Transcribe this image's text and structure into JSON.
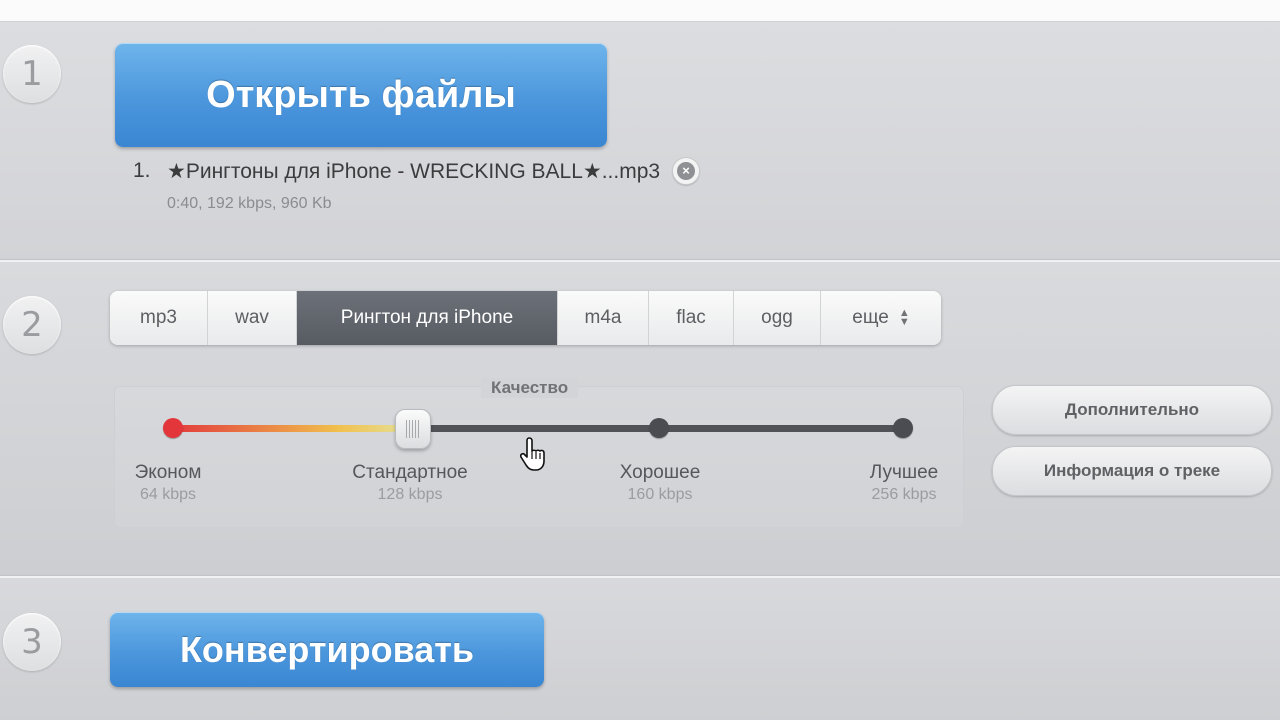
{
  "steps": {
    "one": "1",
    "two": "2",
    "three": "3"
  },
  "open_button": {
    "label": "Открыть файлы"
  },
  "file_list": [
    {
      "index": "1.",
      "name": "★Рингтоны для iPhone - WRECKING BALL★...mp3",
      "meta": "0:40, 192 kbps, 960 Kb"
    }
  ],
  "formats": {
    "items": [
      "mp3",
      "wav",
      "Рингтон для iPhone",
      "m4a",
      "flac",
      "ogg",
      "еще"
    ],
    "selected": "Рингтон для iPhone"
  },
  "quality": {
    "title": "Качество",
    "levels": [
      {
        "name": "Эконом",
        "bitrate": "64 kbps"
      },
      {
        "name": "Стандартное",
        "bitrate": "128 kbps"
      },
      {
        "name": "Хорошее",
        "bitrate": "160 kbps"
      },
      {
        "name": "Лучшее",
        "bitrate": "256 kbps"
      }
    ],
    "selected_index": 1
  },
  "side_buttons": {
    "advanced": "Дополнительно",
    "track_info": "Информация о треке"
  },
  "convert_button": {
    "label": "Конвертировать"
  },
  "colors": {
    "accent_blue": "#4b96dc",
    "active_tab": "#5f636a",
    "slider_red": "#e2363a"
  }
}
